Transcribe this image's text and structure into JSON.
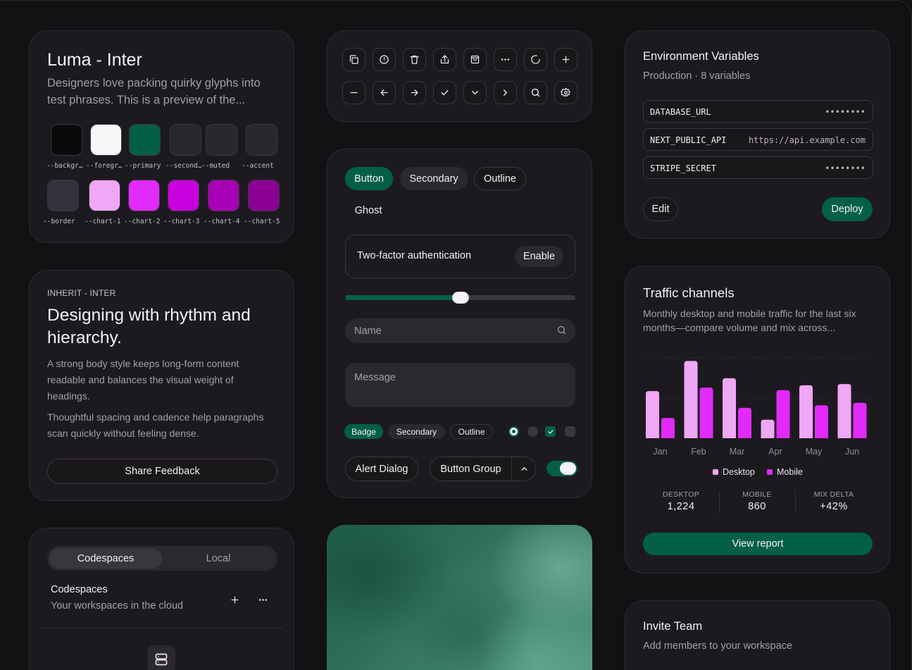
{
  "palette_card": {
    "title": "Luma - Inter",
    "description": "Designers love packing quirky glyphs into test phrases. This is a preview of the...",
    "swatches_row1": [
      {
        "label": "--background",
        "color": "#0a090b"
      },
      {
        "label": "--foreground",
        "color": "#f8f7f8"
      },
      {
        "label": "--primary",
        "color": "#036045"
      },
      {
        "label": "--secondary",
        "color": "#29272c"
      },
      {
        "label": "--muted",
        "color": "#29272c"
      },
      {
        "label": "--accent",
        "color": "#29272c"
      }
    ],
    "swatches_row2": [
      {
        "label": "--border",
        "color": "#34313a"
      },
      {
        "label": "--chart-1",
        "color": "#f0a7f6"
      },
      {
        "label": "--chart-2",
        "color": "#e12afb"
      },
      {
        "label": "--chart-3",
        "color": "#c800de"
      },
      {
        "label": "--chart-4",
        "color": "#a800b7"
      },
      {
        "label": "--chart-5",
        "color": "#8a0194"
      }
    ]
  },
  "typography_card": {
    "eyebrow": "INHERIT - INTER",
    "heading": "Designing with rhythm and hierarchy.",
    "paragraph1": "A strong body style keeps long-form content readable and balances the visual weight of headings.",
    "paragraph2": "Thoughtful spacing and cadence help paragraphs scan quickly without feeling dense.",
    "button": "Share Feedback"
  },
  "codespaces_card": {
    "tabs": [
      "Codespaces",
      "Local"
    ],
    "title": "Codespaces",
    "subtitle": "Your workspaces in the cloud"
  },
  "icon_buttons": {
    "row1": [
      "copy-icon",
      "alert-circle-icon",
      "trash-icon",
      "share-icon",
      "shopping-bag-icon",
      "more-horizontal-icon",
      "loader-icon",
      "plus-icon"
    ],
    "row2": [
      "minus-icon",
      "arrow-left-icon",
      "arrow-right-icon",
      "check-icon",
      "chevron-down-icon",
      "chevron-right-icon",
      "search-icon",
      "settings-icon"
    ]
  },
  "form_card": {
    "buttons": {
      "primary": "Button",
      "secondary": "Secondary",
      "outline": "Outline",
      "ghost": "Ghost"
    },
    "two_factor": {
      "label": "Two-factor authentication",
      "action": "Enable"
    },
    "slider_value": 0.5,
    "name_placeholder": "Name",
    "message_placeholder": "Message",
    "badges": {
      "primary": "Badge",
      "secondary": "Secondary",
      "outline": "Outline"
    },
    "alert_dialog": "Alert Dialog",
    "button_group": "Button Group",
    "switch_on": true
  },
  "env_card": {
    "title": "Environment Variables",
    "subtitle": "Production · 8 variables",
    "rows": [
      {
        "key": "DATABASE_URL",
        "value": "••••••••"
      },
      {
        "key": "NEXT_PUBLIC_API",
        "value": "https://api.example.com"
      },
      {
        "key": "STRIPE_SECRET",
        "value": "••••••••"
      }
    ],
    "edit": "Edit",
    "deploy": "Deploy"
  },
  "traffic_card": {
    "title": "Traffic channels",
    "description": "Monthly desktop and mobile traffic for the last six months—compare volume and mix across...",
    "legend": {
      "desktop": "Desktop",
      "mobile": "Mobile"
    },
    "stats": [
      {
        "label": "DESKTOP",
        "value": "1,224"
      },
      {
        "label": "MOBILE",
        "value": "860"
      },
      {
        "label": "MIX DELTA",
        "value": "+42%"
      }
    ],
    "button": "View report"
  },
  "chart_data": {
    "type": "bar",
    "categories": [
      "Jan",
      "Feb",
      "Mar",
      "Apr",
      "May",
      "Jun"
    ],
    "series": [
      {
        "name": "Desktop",
        "color": "#f0a7f6",
        "values": [
          186,
          305,
          237,
          73,
          209,
          214
        ]
      },
      {
        "name": "Mobile",
        "color": "#e12afb",
        "values": [
          80,
          200,
          120,
          190,
          130,
          140
        ]
      }
    ],
    "ylim": [
      0,
      320
    ],
    "grid": true
  },
  "invite_card": {
    "title": "Invite Team",
    "subtitle": "Add members to your workspace"
  }
}
